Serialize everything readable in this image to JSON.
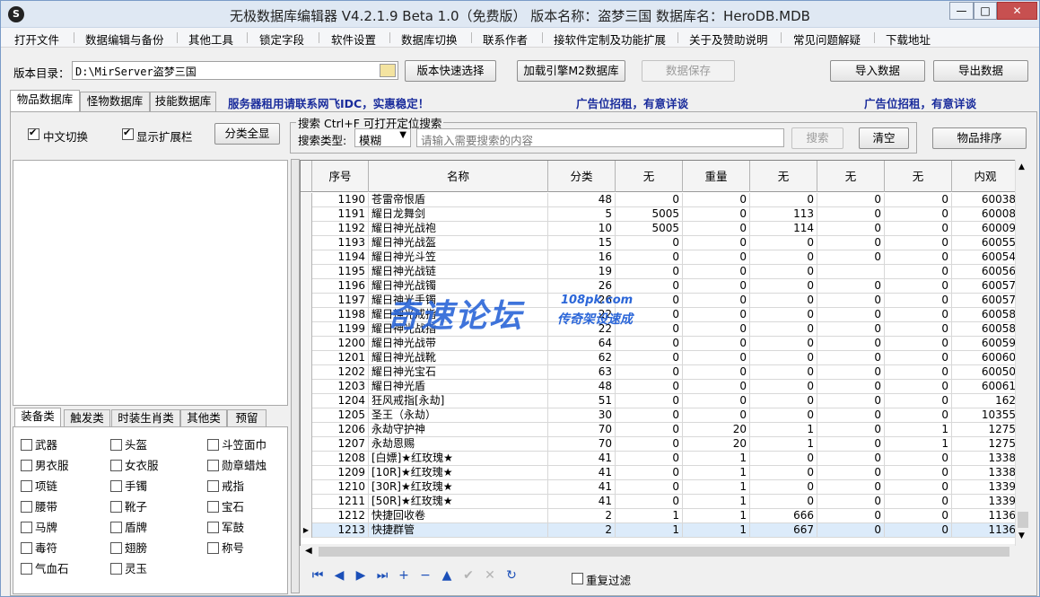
{
  "window": {
    "title": "无极数据库编辑器 V4.2.1.9    Beta 1.0（免费版）    版本名称：盗梦三国      数据库名：HeroDB.MDB",
    "app_icon": "S",
    "min": "—",
    "max": "□",
    "close": "✕"
  },
  "menu": [
    "打开文件",
    "数据编辑与备份",
    "其他工具",
    "锁定字段",
    "软件设置",
    "数据库切换",
    "联系作者",
    "接软件定制及功能扩展",
    "关于及赞助说明",
    "常见问题解疑",
    "下载地址"
  ],
  "toolbar": {
    "dir_label": "版本目录：",
    "dir_value": "D:\\MirServer盗梦三国",
    "quick_select": "版本快速选择",
    "load_engine": "加载引擎M2数据库",
    "save_data": "数据保存",
    "import_data": "导入数据",
    "export_data": "导出数据"
  },
  "tabs": [
    "物品数据库",
    "怪物数据库",
    "技能数据库"
  ],
  "ads": [
    "服务器租用请联系网飞IDC，实惠稳定！",
    "广告位招租，有意详谈",
    "广告位招租，有意详谈"
  ],
  "options": {
    "chinese_toggle": "中文切换",
    "show_ext": "显示扩展栏",
    "expand_all": "分类全显"
  },
  "search": {
    "title": "搜索  Ctrl+F 可打开定位搜索",
    "type_label": "搜索类型:",
    "type_value": "模糊",
    "placeholder": "请输入需要搜索的内容",
    "search_btn": "搜索",
    "clear_btn": "清空",
    "sort_btn": "物品排序"
  },
  "category_tabs": [
    "装备类",
    "触发类",
    "时装生肖类",
    "其他类",
    "预留"
  ],
  "categories": [
    [
      "武器",
      "头盔",
      "斗笠面巾"
    ],
    [
      "男衣服",
      "女衣服",
      "勋章蜡烛"
    ],
    [
      "项链",
      "手镯",
      "戒指"
    ],
    [
      "腰带",
      "靴子",
      "宝石"
    ],
    [
      "马牌",
      "盾牌",
      "军鼓"
    ],
    [
      "毒符",
      "翅膀",
      "称号"
    ],
    [
      "气血石",
      "灵玉",
      ""
    ]
  ],
  "grid": {
    "headers": [
      "序号",
      "名称",
      "分类",
      "无",
      "重量",
      "无",
      "无",
      "无",
      "内观"
    ],
    "rows": [
      [
        "1190",
        "苍雷帝恨盾",
        "48",
        "0",
        "0",
        "0",
        "0",
        "0",
        "60038"
      ],
      [
        "1191",
        "耀日龙舞剑",
        "5",
        "5005",
        "0",
        "113",
        "0",
        "0",
        "60008"
      ],
      [
        "1192",
        "耀日神光战袍",
        "10",
        "5005",
        "0",
        "114",
        "0",
        "0",
        "60009"
      ],
      [
        "1193",
        "耀日神光战盔",
        "15",
        "0",
        "0",
        "0",
        "0",
        "0",
        "60055"
      ],
      [
        "1194",
        "耀日神光斗笠",
        "16",
        "0",
        "0",
        "0",
        "0",
        "0",
        "60054"
      ],
      [
        "1195",
        "耀日神光战链",
        "19",
        "0",
        "0",
        "0",
        "",
        "0",
        "60056"
      ],
      [
        "1196",
        "耀日神光战镯",
        "26",
        "0",
        "0",
        "0",
        "0",
        "0",
        "60057"
      ],
      [
        "1197",
        "耀日神光手镯",
        "26",
        "0",
        "0",
        "0",
        "0",
        "0",
        "60057"
      ],
      [
        "1198",
        "耀日神光戒指",
        "22",
        "0",
        "0",
        "0",
        "0",
        "0",
        "60058"
      ],
      [
        "1199",
        "耀日神光战指",
        "22",
        "0",
        "0",
        "0",
        "0",
        "0",
        "60058"
      ],
      [
        "1200",
        "耀日神光战带",
        "64",
        "0",
        "0",
        "0",
        "0",
        "0",
        "60059"
      ],
      [
        "1201",
        "耀日神光战靴",
        "62",
        "0",
        "0",
        "0",
        "0",
        "0",
        "60060"
      ],
      [
        "1202",
        "耀日神光宝石",
        "63",
        "0",
        "0",
        "0",
        "0",
        "0",
        "60050"
      ],
      [
        "1203",
        "耀日神光盾",
        "48",
        "0",
        "0",
        "0",
        "0",
        "0",
        "60061"
      ],
      [
        "1204",
        "狂风戒指[永劫]",
        "51",
        "0",
        "0",
        "0",
        "0",
        "0",
        "162"
      ],
      [
        "1205",
        "圣王（永劫）",
        "30",
        "0",
        "0",
        "0",
        "0",
        "0",
        "10355"
      ],
      [
        "1206",
        "永劫守护神",
        "70",
        "0",
        "20",
        "1",
        "0",
        "1",
        "1275"
      ],
      [
        "1207",
        "永劫恩赐",
        "70",
        "0",
        "20",
        "1",
        "0",
        "1",
        "1275"
      ],
      [
        "1208",
        "[白嫖]★红玫瑰★",
        "41",
        "0",
        "1",
        "0",
        "0",
        "0",
        "1338"
      ],
      [
        "1209",
        "[10R]★红玫瑰★",
        "41",
        "0",
        "1",
        "0",
        "0",
        "0",
        "1338"
      ],
      [
        "1210",
        "[30R]★红玫瑰★",
        "41",
        "0",
        "1",
        "0",
        "0",
        "0",
        "1339"
      ],
      [
        "1211",
        "[50R]★红玫瑰★",
        "41",
        "0",
        "1",
        "0",
        "0",
        "0",
        "1339"
      ],
      [
        "1212",
        "快捷回收卷",
        "2",
        "1",
        "1",
        "666",
        "0",
        "0",
        "1136"
      ],
      [
        "1213",
        "快捷群管",
        "2",
        "1",
        "1",
        "667",
        "0",
        "0",
        "1136"
      ]
    ],
    "selected_index": 23,
    "indicator": "▶"
  },
  "nav_icons": [
    {
      "name": "first-record-icon",
      "glyph": "⏮",
      "enabled": true
    },
    {
      "name": "prev-record-icon",
      "glyph": "◀",
      "enabled": true
    },
    {
      "name": "next-record-icon",
      "glyph": "▶",
      "enabled": true
    },
    {
      "name": "last-record-icon",
      "glyph": "⏭",
      "enabled": true
    },
    {
      "name": "insert-record-icon",
      "glyph": "+",
      "enabled": true
    },
    {
      "name": "delete-record-icon",
      "glyph": "−",
      "enabled": true
    },
    {
      "name": "edit-record-icon",
      "glyph": "▲",
      "enabled": true
    },
    {
      "name": "post-record-icon",
      "glyph": "✔",
      "enabled": false
    },
    {
      "name": "cancel-record-icon",
      "glyph": "✕",
      "enabled": false
    },
    {
      "name": "refresh-record-icon",
      "glyph": "↻",
      "enabled": true
    }
  ],
  "dup_filter": "重复过滤",
  "watermark": {
    "main": "奇速论坛",
    "site": "108pk.com",
    "sub": "传奇架设速成"
  }
}
